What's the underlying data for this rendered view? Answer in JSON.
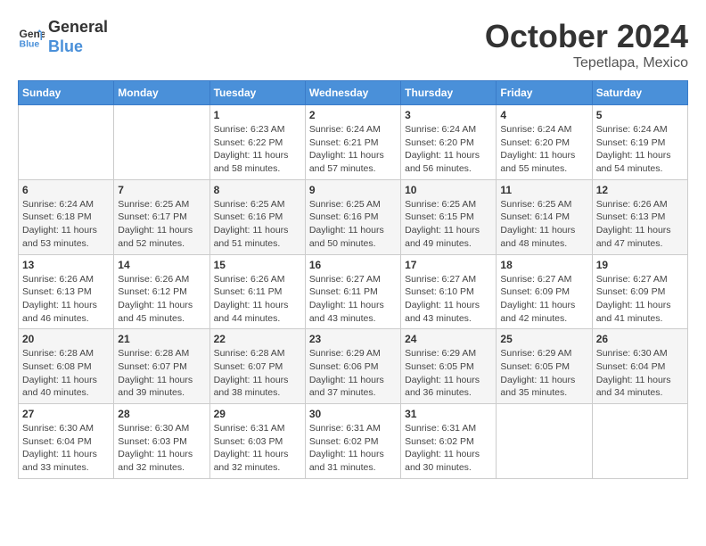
{
  "header": {
    "logo_line1": "General",
    "logo_line2": "Blue",
    "month": "October 2024",
    "location": "Tepetlapa, Mexico"
  },
  "weekdays": [
    "Sunday",
    "Monday",
    "Tuesday",
    "Wednesday",
    "Thursday",
    "Friday",
    "Saturday"
  ],
  "weeks": [
    [
      {
        "day": "",
        "info": ""
      },
      {
        "day": "",
        "info": ""
      },
      {
        "day": "1",
        "info": "Sunrise: 6:23 AM\nSunset: 6:22 PM\nDaylight: 11 hours and 58 minutes."
      },
      {
        "day": "2",
        "info": "Sunrise: 6:24 AM\nSunset: 6:21 PM\nDaylight: 11 hours and 57 minutes."
      },
      {
        "day": "3",
        "info": "Sunrise: 6:24 AM\nSunset: 6:20 PM\nDaylight: 11 hours and 56 minutes."
      },
      {
        "day": "4",
        "info": "Sunrise: 6:24 AM\nSunset: 6:20 PM\nDaylight: 11 hours and 55 minutes."
      },
      {
        "day": "5",
        "info": "Sunrise: 6:24 AM\nSunset: 6:19 PM\nDaylight: 11 hours and 54 minutes."
      }
    ],
    [
      {
        "day": "6",
        "info": "Sunrise: 6:24 AM\nSunset: 6:18 PM\nDaylight: 11 hours and 53 minutes."
      },
      {
        "day": "7",
        "info": "Sunrise: 6:25 AM\nSunset: 6:17 PM\nDaylight: 11 hours and 52 minutes."
      },
      {
        "day": "8",
        "info": "Sunrise: 6:25 AM\nSunset: 6:16 PM\nDaylight: 11 hours and 51 minutes."
      },
      {
        "day": "9",
        "info": "Sunrise: 6:25 AM\nSunset: 6:16 PM\nDaylight: 11 hours and 50 minutes."
      },
      {
        "day": "10",
        "info": "Sunrise: 6:25 AM\nSunset: 6:15 PM\nDaylight: 11 hours and 49 minutes."
      },
      {
        "day": "11",
        "info": "Sunrise: 6:25 AM\nSunset: 6:14 PM\nDaylight: 11 hours and 48 minutes."
      },
      {
        "day": "12",
        "info": "Sunrise: 6:26 AM\nSunset: 6:13 PM\nDaylight: 11 hours and 47 minutes."
      }
    ],
    [
      {
        "day": "13",
        "info": "Sunrise: 6:26 AM\nSunset: 6:13 PM\nDaylight: 11 hours and 46 minutes."
      },
      {
        "day": "14",
        "info": "Sunrise: 6:26 AM\nSunset: 6:12 PM\nDaylight: 11 hours and 45 minutes."
      },
      {
        "day": "15",
        "info": "Sunrise: 6:26 AM\nSunset: 6:11 PM\nDaylight: 11 hours and 44 minutes."
      },
      {
        "day": "16",
        "info": "Sunrise: 6:27 AM\nSunset: 6:11 PM\nDaylight: 11 hours and 43 minutes."
      },
      {
        "day": "17",
        "info": "Sunrise: 6:27 AM\nSunset: 6:10 PM\nDaylight: 11 hours and 43 minutes."
      },
      {
        "day": "18",
        "info": "Sunrise: 6:27 AM\nSunset: 6:09 PM\nDaylight: 11 hours and 42 minutes."
      },
      {
        "day": "19",
        "info": "Sunrise: 6:27 AM\nSunset: 6:09 PM\nDaylight: 11 hours and 41 minutes."
      }
    ],
    [
      {
        "day": "20",
        "info": "Sunrise: 6:28 AM\nSunset: 6:08 PM\nDaylight: 11 hours and 40 minutes."
      },
      {
        "day": "21",
        "info": "Sunrise: 6:28 AM\nSunset: 6:07 PM\nDaylight: 11 hours and 39 minutes."
      },
      {
        "day": "22",
        "info": "Sunrise: 6:28 AM\nSunset: 6:07 PM\nDaylight: 11 hours and 38 minutes."
      },
      {
        "day": "23",
        "info": "Sunrise: 6:29 AM\nSunset: 6:06 PM\nDaylight: 11 hours and 37 minutes."
      },
      {
        "day": "24",
        "info": "Sunrise: 6:29 AM\nSunset: 6:05 PM\nDaylight: 11 hours and 36 minutes."
      },
      {
        "day": "25",
        "info": "Sunrise: 6:29 AM\nSunset: 6:05 PM\nDaylight: 11 hours and 35 minutes."
      },
      {
        "day": "26",
        "info": "Sunrise: 6:30 AM\nSunset: 6:04 PM\nDaylight: 11 hours and 34 minutes."
      }
    ],
    [
      {
        "day": "27",
        "info": "Sunrise: 6:30 AM\nSunset: 6:04 PM\nDaylight: 11 hours and 33 minutes."
      },
      {
        "day": "28",
        "info": "Sunrise: 6:30 AM\nSunset: 6:03 PM\nDaylight: 11 hours and 32 minutes."
      },
      {
        "day": "29",
        "info": "Sunrise: 6:31 AM\nSunset: 6:03 PM\nDaylight: 11 hours and 32 minutes."
      },
      {
        "day": "30",
        "info": "Sunrise: 6:31 AM\nSunset: 6:02 PM\nDaylight: 11 hours and 31 minutes."
      },
      {
        "day": "31",
        "info": "Sunrise: 6:31 AM\nSunset: 6:02 PM\nDaylight: 11 hours and 30 minutes."
      },
      {
        "day": "",
        "info": ""
      },
      {
        "day": "",
        "info": ""
      }
    ]
  ]
}
